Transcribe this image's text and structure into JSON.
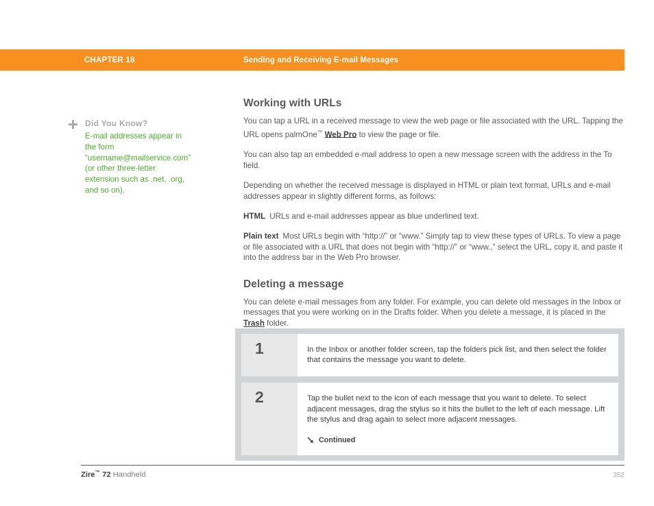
{
  "header": {
    "chapter": "CHAPTER 18",
    "title": "Sending and Receiving E-mail Messages",
    "bar_color": "#F7901E"
  },
  "sidebar": {
    "icon": "plus-icon",
    "heading": "Did You Know?",
    "body": "E-mail addresses appear in the form “username@mailservice.com” (or other three-letter extension such as .net, .org, and so on).",
    "text_color": "#4CAF2A"
  },
  "main": {
    "section1": {
      "title": "Working with URLs",
      "paragraph1_part1": "You can tap a URL in a received message to view the web page or file associated with the URL. Tapping the URL opens palmOne",
      "paragraph1_tm": "™",
      "paragraph1_link": "Web Pro",
      "paragraph1_part2": " to view the page or file.",
      "paragraph2": "You can also tap an embedded e-mail address to open a new message screen with the address in the To field.",
      "paragraph3": "Depending on whether the received message is displayed in HTML or plain text format, URLs and e-mail addresses appear in slightly different forms, as follows:",
      "html_label": "HTML",
      "html_text": "URLs and e-mail addresses appear as blue underlined text.",
      "plaintext_label": "Plain text",
      "plaintext_text": "Most URLs begin with “http://” or “www.” Simply tap to view these types of URLs. To view a page or file associated with a URL that does not begin with “http://” or “www.,” select the URL, copy it, and paste it into the address bar in the Web Pro browser."
    },
    "section2": {
      "title": "Deleting a message",
      "paragraph1_part1": "You can delete e-mail messages from any folder. For example, you can delete old messages in the Inbox or messages that you were working on in the Drafts folder. When you delete a message, it is placed in the ",
      "paragraph1_link": "Trash",
      "paragraph1_part2": " folder."
    }
  },
  "steps": [
    {
      "number": "1",
      "text": "In the Inbox or another folder screen, tap the folders pick list, and then select the folder that contains the message you want to delete."
    },
    {
      "number": "2",
      "text": "Tap the bullet next to the icon of each message that you want to delete. To select adjacent messages, drag the stylus so it hits the bullet to the left of each message. Lift the stylus and drag again to select more adjacent messages.",
      "continued_label": "Continued",
      "continued_icon": "arrow-down-right-icon"
    }
  ],
  "footer": {
    "product": "Zire",
    "trademark": "™",
    "model": "72",
    "device": "Handheld",
    "page_number": "352"
  }
}
